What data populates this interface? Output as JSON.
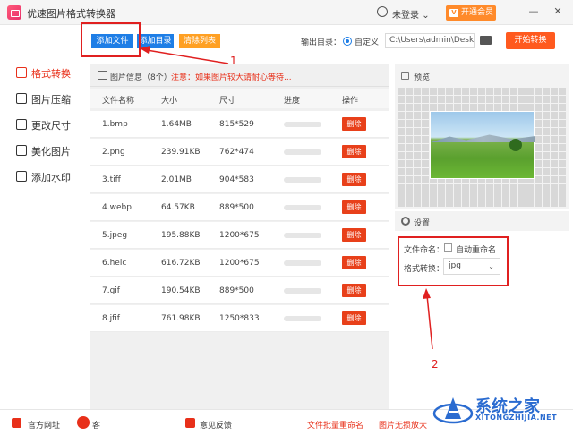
{
  "window": {
    "title": "优速图片格式转换器",
    "user_label": "未登录",
    "vip_label": "开通会员",
    "min_glyph": "—",
    "close_glyph": "✕",
    "user_chevron": "⌄"
  },
  "toolbar": {
    "add_file": "添加文件",
    "add_folder": "添加目录",
    "clear_list": "清除列表",
    "output_label": "输出目录：",
    "output_option": "自定义",
    "output_path": "C:\\Users\\admin\\Deskto",
    "start": "开始转换"
  },
  "sidebar": {
    "items": [
      {
        "label": "格式转换",
        "icon": "format-convert-icon"
      },
      {
        "label": "图片压缩",
        "icon": "compress-icon"
      },
      {
        "label": "更改尺寸",
        "icon": "resize-icon"
      },
      {
        "label": "美化图片",
        "icon": "beautify-icon"
      },
      {
        "label": "添加水印",
        "icon": "watermark-icon"
      }
    ]
  },
  "file_panel": {
    "info_label": "图片信息（8个）",
    "warning": "注意：如果图片较大请耐心等待...",
    "columns": {
      "name": "文件名称",
      "size": "大小",
      "dims": "尺寸",
      "progress": "进度",
      "action": "操作"
    },
    "delete_label": "删除",
    "rows": [
      {
        "name": "1.bmp",
        "size": "1.64MB",
        "dims": "815*529",
        "progress": 0
      },
      {
        "name": "2.png",
        "size": "239.91KB",
        "dims": "762*474",
        "progress": 0
      },
      {
        "name": "3.tiff",
        "size": "2.01MB",
        "dims": "904*583",
        "progress": 0
      },
      {
        "name": "4.webp",
        "size": "64.57KB",
        "dims": "889*500",
        "progress": 0
      },
      {
        "name": "5.jpeg",
        "size": "195.88KB",
        "dims": "1200*675",
        "progress": 0
      },
      {
        "name": "6.heic",
        "size": "616.72KB",
        "dims": "1200*675",
        "progress": 0
      },
      {
        "name": "7.gif",
        "size": "190.54KB",
        "dims": "889*500",
        "progress": 0
      },
      {
        "name": "8.jfif",
        "size": "761.98KB",
        "dims": "1250*833",
        "progress": 0
      }
    ]
  },
  "preview": {
    "title": "预览"
  },
  "settings": {
    "title": "设置",
    "naming_label": "文件命名：",
    "auto_rename": "自动重命名",
    "format_label": "格式转换：",
    "format_value": "jpg"
  },
  "annotations": {
    "step1": "1",
    "step2": "2"
  },
  "footer": {
    "website": "官方网址",
    "contact": "客",
    "feedback": "意见反馈",
    "batch_rename": "文件批量重命名",
    "enlarge": "图片无损放大"
  },
  "watermark": {
    "brand": "系统之家",
    "domain": "XITONGZHIJIA.NET"
  },
  "colors": {
    "accent_blue": "#1e7ee6",
    "accent_red": "#e8301a",
    "start_orange": "#ff5a1f",
    "clear_orange": "#ffa023",
    "vip_orange": "#ff8a2a",
    "annotation_red": "#e02020"
  }
}
